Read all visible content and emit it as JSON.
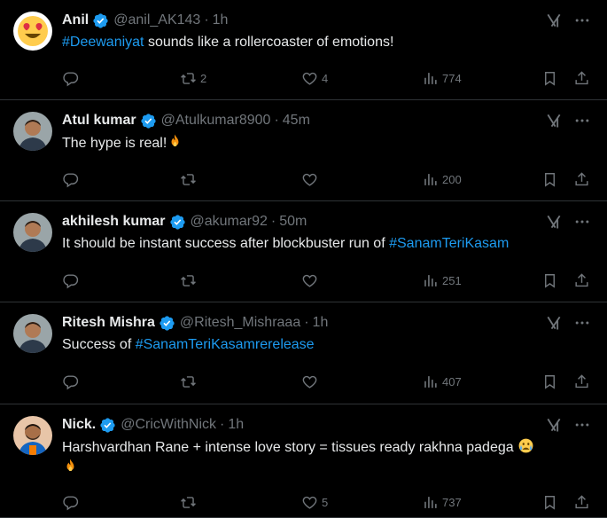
{
  "colors": {
    "accent": "#1d9bf0",
    "muted": "#71767b",
    "text": "#e7e9ea",
    "divider": "#2f3336"
  },
  "tweets": [
    {
      "name": "Anil",
      "handle": "@anil_AK143",
      "time": "1h",
      "avatar_icon": "heart-eyes-emoji-avatar",
      "text_parts": [
        [
          "#Deewaniyat",
          true
        ],
        [
          " sounds like a rollercoaster of emotions!",
          false
        ]
      ],
      "replies": "",
      "retweets": "2",
      "likes": "4",
      "views": "774"
    },
    {
      "name": "Atul kumar",
      "handle": "@Atulkumar8900",
      "time": "45m",
      "avatar_icon": "man-photo-avatar",
      "text_parts": [
        [
          "The hype is real!",
          false
        ]
      ],
      "trailing_emoji": "fire",
      "replies": "",
      "retweets": "",
      "likes": "",
      "views": "200"
    },
    {
      "name": "akhilesh kumar",
      "handle": "@akumar92",
      "time": "50m",
      "avatar_icon": "man-photo-avatar",
      "text_parts": [
        [
          "It should be instant success after blockbuster run of ",
          false
        ],
        [
          "#SanamTeriKasam",
          true
        ]
      ],
      "replies": "",
      "retweets": "",
      "likes": "",
      "views": "251"
    },
    {
      "name": "Ritesh Mishra",
      "handle": "@Ritesh_Mishraaa",
      "time": "1h",
      "avatar_icon": "man-photo-avatar",
      "text_parts": [
        [
          "Success of ",
          false
        ],
        [
          "#SanamTeriKasamrerelease",
          true
        ]
      ],
      "replies": "",
      "retweets": "",
      "likes": "",
      "views": "407"
    },
    {
      "name": "Nick.",
      "handle": "@CricWithNick",
      "time": "1h",
      "avatar_icon": "cricketer-photo-avatar",
      "text_parts": [
        [
          "Harshvardhan Rane + intense love story = tissues ready rakhna padega ",
          false
        ]
      ],
      "trailing_emoji": "crying-face",
      "second_line_emoji": "fire",
      "replies": "",
      "retweets": "",
      "likes": "5",
      "views": "737"
    }
  ]
}
